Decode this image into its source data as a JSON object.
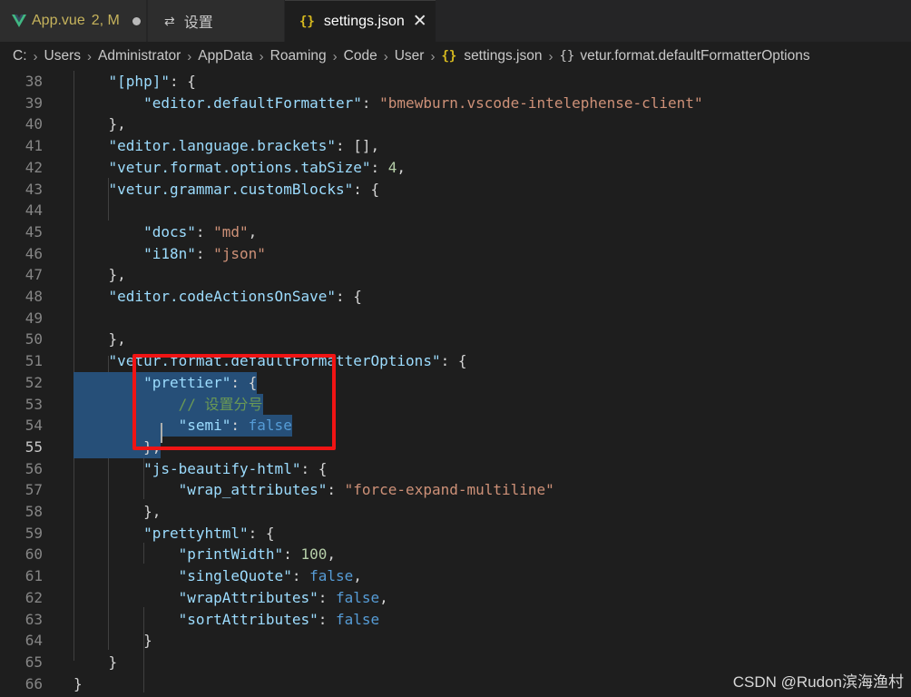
{
  "tabs": [
    {
      "label": "App.vue",
      "status": "2, M",
      "icon": "vue-logo-icon"
    },
    {
      "label": "设置",
      "icon": "settings-icon"
    },
    {
      "label": "settings.json",
      "icon": "json-braces-icon",
      "close": "✕"
    }
  ],
  "breadcrumb": [
    "C:",
    "Users",
    "Administrator",
    "AppData",
    "Roaming",
    "Code",
    "User",
    "settings.json",
    "vetur.format.defaultFormatterOptions"
  ],
  "watermark": "CSDN @Rudon滨海渔村",
  "colors": {
    "accent_red": "#f01414",
    "selection": "#264f78",
    "key": "#9cdcfe",
    "string": "#ce9178",
    "number": "#b5cea8",
    "boolean": "#569cd6",
    "comment": "#6a9955"
  },
  "lines": [
    {
      "n": "38",
      "tokens": [
        [
          "p",
          "    "
        ],
        [
          "k",
          "\"[php]\""
        ],
        [
          "p",
          ": {"
        ]
      ]
    },
    {
      "n": "39",
      "tokens": [
        [
          "p",
          "        "
        ],
        [
          "k",
          "\"editor.defaultFormatter\""
        ],
        [
          "p",
          ": "
        ],
        [
          "s",
          "\"bmewburn.vscode-intelephense-client\""
        ]
      ]
    },
    {
      "n": "40",
      "tokens": [
        [
          "p",
          "    },"
        ]
      ]
    },
    {
      "n": "41",
      "tokens": [
        [
          "p",
          "    "
        ],
        [
          "k",
          "\"editor.language.brackets\""
        ],
        [
          "p",
          ": [],"
        ]
      ]
    },
    {
      "n": "42",
      "tokens": [
        [
          "p",
          "    "
        ],
        [
          "k",
          "\"vetur.format.options.tabSize\""
        ],
        [
          "p",
          ": "
        ],
        [
          "n",
          "4"
        ],
        [
          "p",
          ","
        ]
      ]
    },
    {
      "n": "43",
      "tokens": [
        [
          "p",
          "    "
        ],
        [
          "k",
          "\"vetur.grammar.customBlocks\""
        ],
        [
          "p",
          ": {"
        ]
      ]
    },
    {
      "n": "44",
      "tokens": []
    },
    {
      "n": "45",
      "tokens": [
        [
          "p",
          "        "
        ],
        [
          "k",
          "\"docs\""
        ],
        [
          "p",
          ": "
        ],
        [
          "s",
          "\"md\""
        ],
        [
          "p",
          ","
        ]
      ]
    },
    {
      "n": "46",
      "tokens": [
        [
          "p",
          "        "
        ],
        [
          "k",
          "\"i18n\""
        ],
        [
          "p",
          ": "
        ],
        [
          "s",
          "\"json\""
        ]
      ]
    },
    {
      "n": "47",
      "tokens": [
        [
          "p",
          "    },"
        ]
      ]
    },
    {
      "n": "48",
      "tokens": [
        [
          "p",
          "    "
        ],
        [
          "k",
          "\"editor.codeActionsOnSave\""
        ],
        [
          "p",
          ": {"
        ]
      ]
    },
    {
      "n": "49",
      "tokens": []
    },
    {
      "n": "50",
      "tokens": [
        [
          "p",
          "    },"
        ]
      ]
    },
    {
      "n": "51",
      "tokens": [
        [
          "p",
          "    "
        ],
        [
          "k",
          "\"vetur.format.defaultFormatterOptions\""
        ],
        [
          "p",
          ": {"
        ]
      ]
    },
    {
      "n": "52",
      "tokens": [
        [
          "p",
          "        "
        ],
        [
          "k",
          "\"prettier\""
        ],
        [
          "p",
          ": {"
        ]
      ]
    },
    {
      "n": "53",
      "tokens": [
        [
          "p",
          "            "
        ],
        [
          "c",
          "// 设置分号"
        ]
      ]
    },
    {
      "n": "54",
      "tokens": [
        [
          "p",
          "            "
        ],
        [
          "k",
          "\"semi\""
        ],
        [
          "p",
          ": "
        ],
        [
          "b",
          "false"
        ]
      ]
    },
    {
      "n": "55",
      "tokens": [
        [
          "p",
          "        },"
        ]
      ]
    },
    {
      "n": "56",
      "tokens": [
        [
          "p",
          "        "
        ],
        [
          "k",
          "\"js-beautify-html\""
        ],
        [
          "p",
          ": {"
        ]
      ]
    },
    {
      "n": "57",
      "tokens": [
        [
          "p",
          "            "
        ],
        [
          "k",
          "\"wrap_attributes\""
        ],
        [
          "p",
          ": "
        ],
        [
          "s",
          "\"force-expand-multiline\""
        ]
      ]
    },
    {
      "n": "58",
      "tokens": [
        [
          "p",
          "        },"
        ]
      ]
    },
    {
      "n": "59",
      "tokens": [
        [
          "p",
          "        "
        ],
        [
          "k",
          "\"prettyhtml\""
        ],
        [
          "p",
          ": {"
        ]
      ]
    },
    {
      "n": "60",
      "tokens": [
        [
          "p",
          "            "
        ],
        [
          "k",
          "\"printWidth\""
        ],
        [
          "p",
          ": "
        ],
        [
          "n",
          "100"
        ],
        [
          "p",
          ","
        ]
      ]
    },
    {
      "n": "61",
      "tokens": [
        [
          "p",
          "            "
        ],
        [
          "k",
          "\"singleQuote\""
        ],
        [
          "p",
          ": "
        ],
        [
          "b",
          "false"
        ],
        [
          "p",
          ","
        ]
      ]
    },
    {
      "n": "62",
      "tokens": [
        [
          "p",
          "            "
        ],
        [
          "k",
          "\"wrapAttributes\""
        ],
        [
          "p",
          ": "
        ],
        [
          "b",
          "false"
        ],
        [
          "p",
          ","
        ]
      ]
    },
    {
      "n": "63",
      "tokens": [
        [
          "p",
          "            "
        ],
        [
          "k",
          "\"sortAttributes\""
        ],
        [
          "p",
          ": "
        ],
        [
          "b",
          "false"
        ]
      ]
    },
    {
      "n": "64",
      "tokens": [
        [
          "p",
          "        }"
        ]
      ]
    },
    {
      "n": "65",
      "tokens": [
        [
          "p",
          "    }"
        ]
      ]
    },
    {
      "n": "66",
      "tokens": [
        [
          "p",
          "}"
        ]
      ]
    }
  ],
  "active_line": "55",
  "selected_lines": [
    "52",
    "53",
    "54",
    "55"
  ]
}
